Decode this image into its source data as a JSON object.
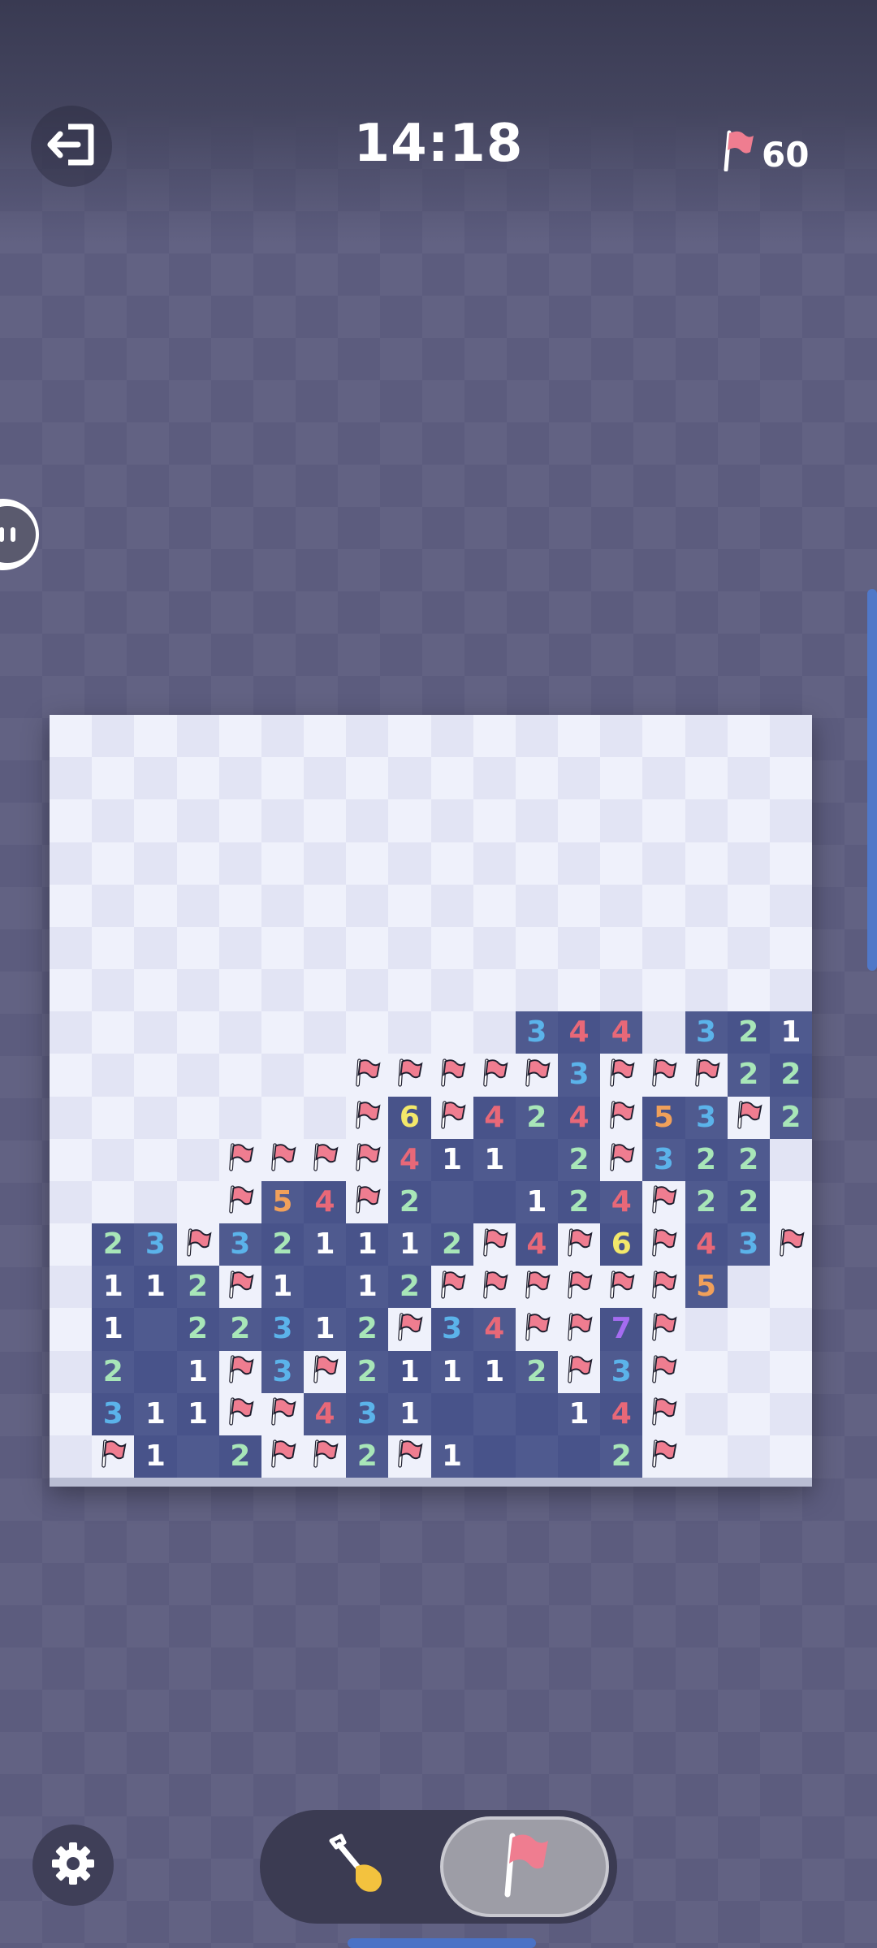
{
  "header": {
    "exit_icon": "exit-door-icon",
    "timer": "14:18",
    "flag_icon": "flag-icon",
    "flags_remaining": "60"
  },
  "colors": {
    "1": "#ffffff",
    "2": "#a8e6b8",
    "3": "#5bb3ea",
    "4": "#e86878",
    "5": "#f0a05a",
    "6": "#f3e86a",
    "7": "#a56cf0",
    "flag": "#ef7d90",
    "background": "#5c5c7e",
    "revealed": "#4f5a8f",
    "unrevealed": "#eff1fb"
  },
  "board": {
    "rows": 18,
    "cols": 18,
    "legend": "U = unrevealed, F = flag, . = revealed empty, digit = adjacent mine count",
    "grid": [
      "UUUUUUUUUUUUUUUUUU",
      "UUUUUUUUUUUUUUUUUU",
      "UUUUUUUUUUUUUUUUUU",
      "UUUUUUUUUUUUUUUUUU",
      "UUUUUUUUUUUUUUUUUU",
      "UUUUUUUUUUUUUUUUUU",
      "UUUUUUUUUUUUUUUUUU",
      "UUUUUUUUUUU344U321",
      "UUUUUUUFFFFF3FFF22",
      "UUUUUUUF6F424F53F2",
      "UUUUFFFF411.2F322U",
      "UUUUF54F2..124F22U",
      "U23F321112F4F6F43F",
      "U112F1.12FFFFFF5UU",
      "U1.22312F34FF7FUUU",
      "U2.1F3F21112F3FUUU",
      "U311FF431...14FUUU",
      "UF1.2FF2F1...2FUUU"
    ]
  },
  "controls": {
    "settings_icon": "gear-icon",
    "dig_tool_icon": "shovel-icon",
    "flag_tool_icon": "flag-icon",
    "active_tool": "flag"
  }
}
